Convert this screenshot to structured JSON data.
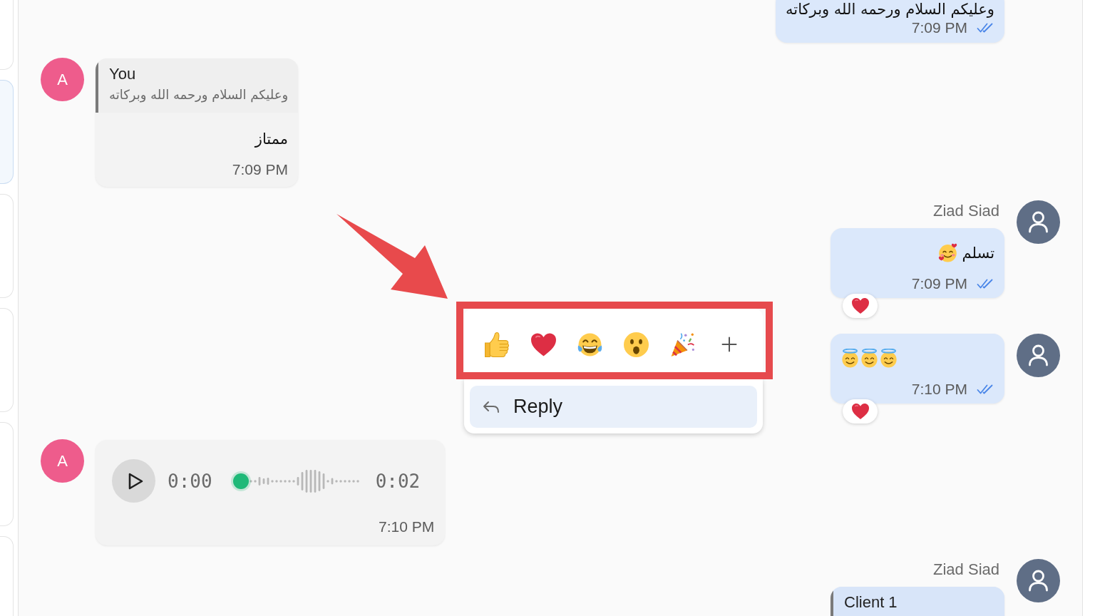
{
  "sidebar": {
    "items": [
      {
        "selected": false
      },
      {
        "selected": true
      },
      {
        "selected": false
      },
      {
        "selected": false
      },
      {
        "selected": false
      },
      {
        "selected": false
      }
    ]
  },
  "messages": [
    {
      "outgoing": true,
      "kind": "text",
      "text": "وعليكم السلام ورحمه الله وبركاته",
      "time": "7:09 PM",
      "read": true
    },
    {
      "outgoing": false,
      "kind": "text",
      "avatar": {
        "kind": "initial",
        "initial": "A"
      },
      "reply_to": {
        "author": "You",
        "text": "وعليكم السلام ورحمه الله وبركاته"
      },
      "text": "ممتاز",
      "time": "7:09 PM"
    },
    {
      "outgoing": true,
      "kind": "text",
      "sender": "Ziad Siad",
      "avatar": {
        "kind": "silhouette"
      },
      "text": "تسلم",
      "emojis": [
        {
          "kind": "smiling-face-with-hearts"
        }
      ],
      "time": "7:09 PM",
      "read": true,
      "reaction": {
        "kind": "heart"
      }
    },
    {
      "outgoing": true,
      "kind": "text",
      "avatar": {
        "kind": "silhouette"
      },
      "emojis": [
        {
          "kind": "smiling-face-with-halo"
        },
        {
          "kind": "smiling-face-with-halo"
        },
        {
          "kind": "smiling-face-with-halo"
        }
      ],
      "time": "7:10 PM",
      "read": true,
      "reaction": {
        "kind": "heart"
      }
    },
    {
      "outgoing": false,
      "kind": "audio",
      "avatar": {
        "kind": "initial",
        "initial": "A"
      },
      "audio": {
        "position": "0:00",
        "duration": "0:02",
        "level": 0
      },
      "time": "7:10 PM"
    },
    {
      "outgoing": true,
      "kind": "text",
      "sender": "Ziad Siad",
      "avatar": {
        "kind": "silhouette"
      },
      "reply_to": {
        "author": "Client 1"
      }
    }
  ],
  "context_menu": {
    "reactions": [
      {
        "kind": "thumbs-up"
      },
      {
        "kind": "heart"
      },
      {
        "kind": "tears-of-joy"
      },
      {
        "kind": "surprised"
      },
      {
        "kind": "party-popper"
      },
      {
        "kind": "add"
      }
    ],
    "items": [
      {
        "label": "Reply",
        "selected": true
      }
    ]
  },
  "annotation": {
    "arrow": true,
    "frame": true
  }
}
